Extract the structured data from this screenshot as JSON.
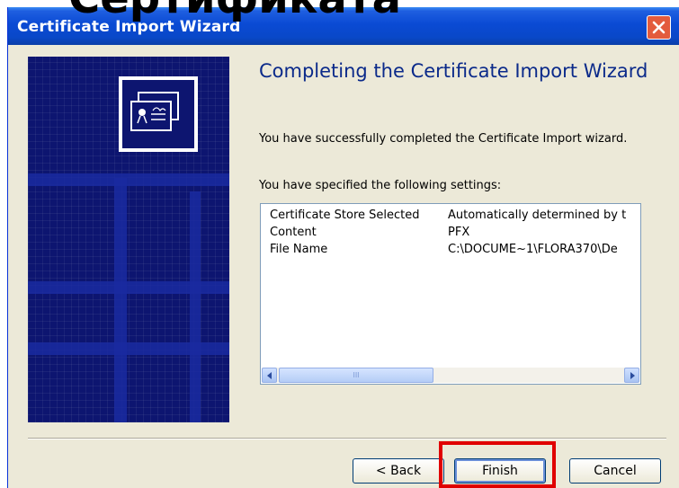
{
  "overlay": {
    "heading_text": "Сертификата"
  },
  "window": {
    "title": "Certificate Import Wizard"
  },
  "wizard": {
    "heading": "Completing the Certificate Import Wizard",
    "success_text": "You have successfully completed the Certificate Import wizard.",
    "settings_intro": "You have specified the following settings:",
    "settings": [
      {
        "name": "Certificate Store Selected",
        "value": "Automatically determined by t"
      },
      {
        "name": "Content",
        "value": "PFX"
      },
      {
        "name": "File Name",
        "value": "C:\\DOCUME~1\\FLORA370\\De"
      }
    ],
    "scroll_thumb_grip": "III"
  },
  "buttons": {
    "back": "< Back",
    "finish": "Finish",
    "cancel": "Cancel"
  },
  "colors": {
    "highlight": "#e00000",
    "titlebar": "#0a4ad4",
    "banner": "#0d1570"
  }
}
